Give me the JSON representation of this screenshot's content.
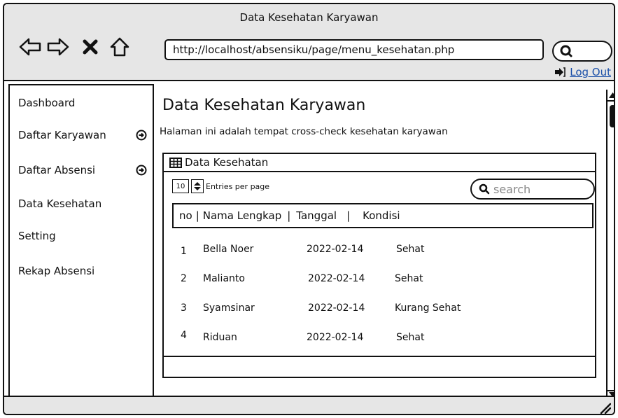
{
  "window": {
    "title": "Data Kesehatan Karyawan",
    "url": "http://localhost/absensiku/page/menu_kesehatan.php",
    "logout_label": "Log Out"
  },
  "sidebar": {
    "items": [
      {
        "label": "Dashboard",
        "has_arrow": false
      },
      {
        "label": "Daftar Karyawan",
        "has_arrow": true
      },
      {
        "label": "Daftar Absensi",
        "has_arrow": true
      },
      {
        "label": "Data Kesehatan",
        "has_arrow": false
      },
      {
        "label": "Setting",
        "has_arrow": false
      },
      {
        "label": "Rekap Absensi",
        "has_arrow": false
      }
    ]
  },
  "main": {
    "title": "Data Kesehatan Karyawan",
    "description": "Halaman ini adalah tempat cross-check kesehatan karyawan",
    "panel": {
      "title": "Data Kesehatan",
      "entries_value": "10",
      "entries_label": "Entries per page",
      "search_placeholder": "search",
      "columns": [
        "no",
        "Nama Lengkap",
        "Tanggal",
        "Kondisi"
      ],
      "rows": [
        {
          "no": "1",
          "name": "Bella Noer",
          "date": "2022-02-14",
          "condition": "Sehat"
        },
        {
          "no": "2",
          "name": "Malianto",
          "date": "2022-02-14",
          "condition": "Sehat"
        },
        {
          "no": "3",
          "name": "Syamsinar",
          "date": "2022-02-14",
          "condition": "Kurang Sehat"
        },
        {
          "no": "4",
          "name": "Riduan",
          "date": "2022-02-14",
          "condition": "Sehat"
        }
      ]
    }
  },
  "colors": {
    "chrome": "#e6e6e6",
    "link": "#1a4fa8"
  },
  "icons": [
    "back-arrow-icon",
    "forward-arrow-icon",
    "close-icon",
    "home-icon",
    "search-icon",
    "logout-icon",
    "circle-arrow-right-icon",
    "table-grid-icon",
    "stepper-icon",
    "resize-grip-icon"
  ]
}
